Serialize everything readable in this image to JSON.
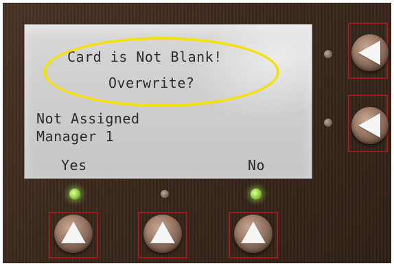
{
  "lcd": {
    "line1": "Card is Not Blank!",
    "line2": "Overwrite?",
    "line3": "Not Assigned",
    "line4": "Manager 1",
    "softkey_left": "Yes",
    "softkey_right": "No"
  },
  "indicators": {
    "right_top": "off",
    "right_bottom": "off",
    "bottom_left": "on",
    "bottom_middle": "off",
    "bottom_right": "on"
  },
  "colors": {
    "highlight": "#f4e10c",
    "led_on": "#9ad54a",
    "button_frame": "#9b1c1c"
  },
  "icons": {
    "right_buttons": "left-arrow-icon",
    "bottom_buttons": "up-arrow-icon"
  }
}
